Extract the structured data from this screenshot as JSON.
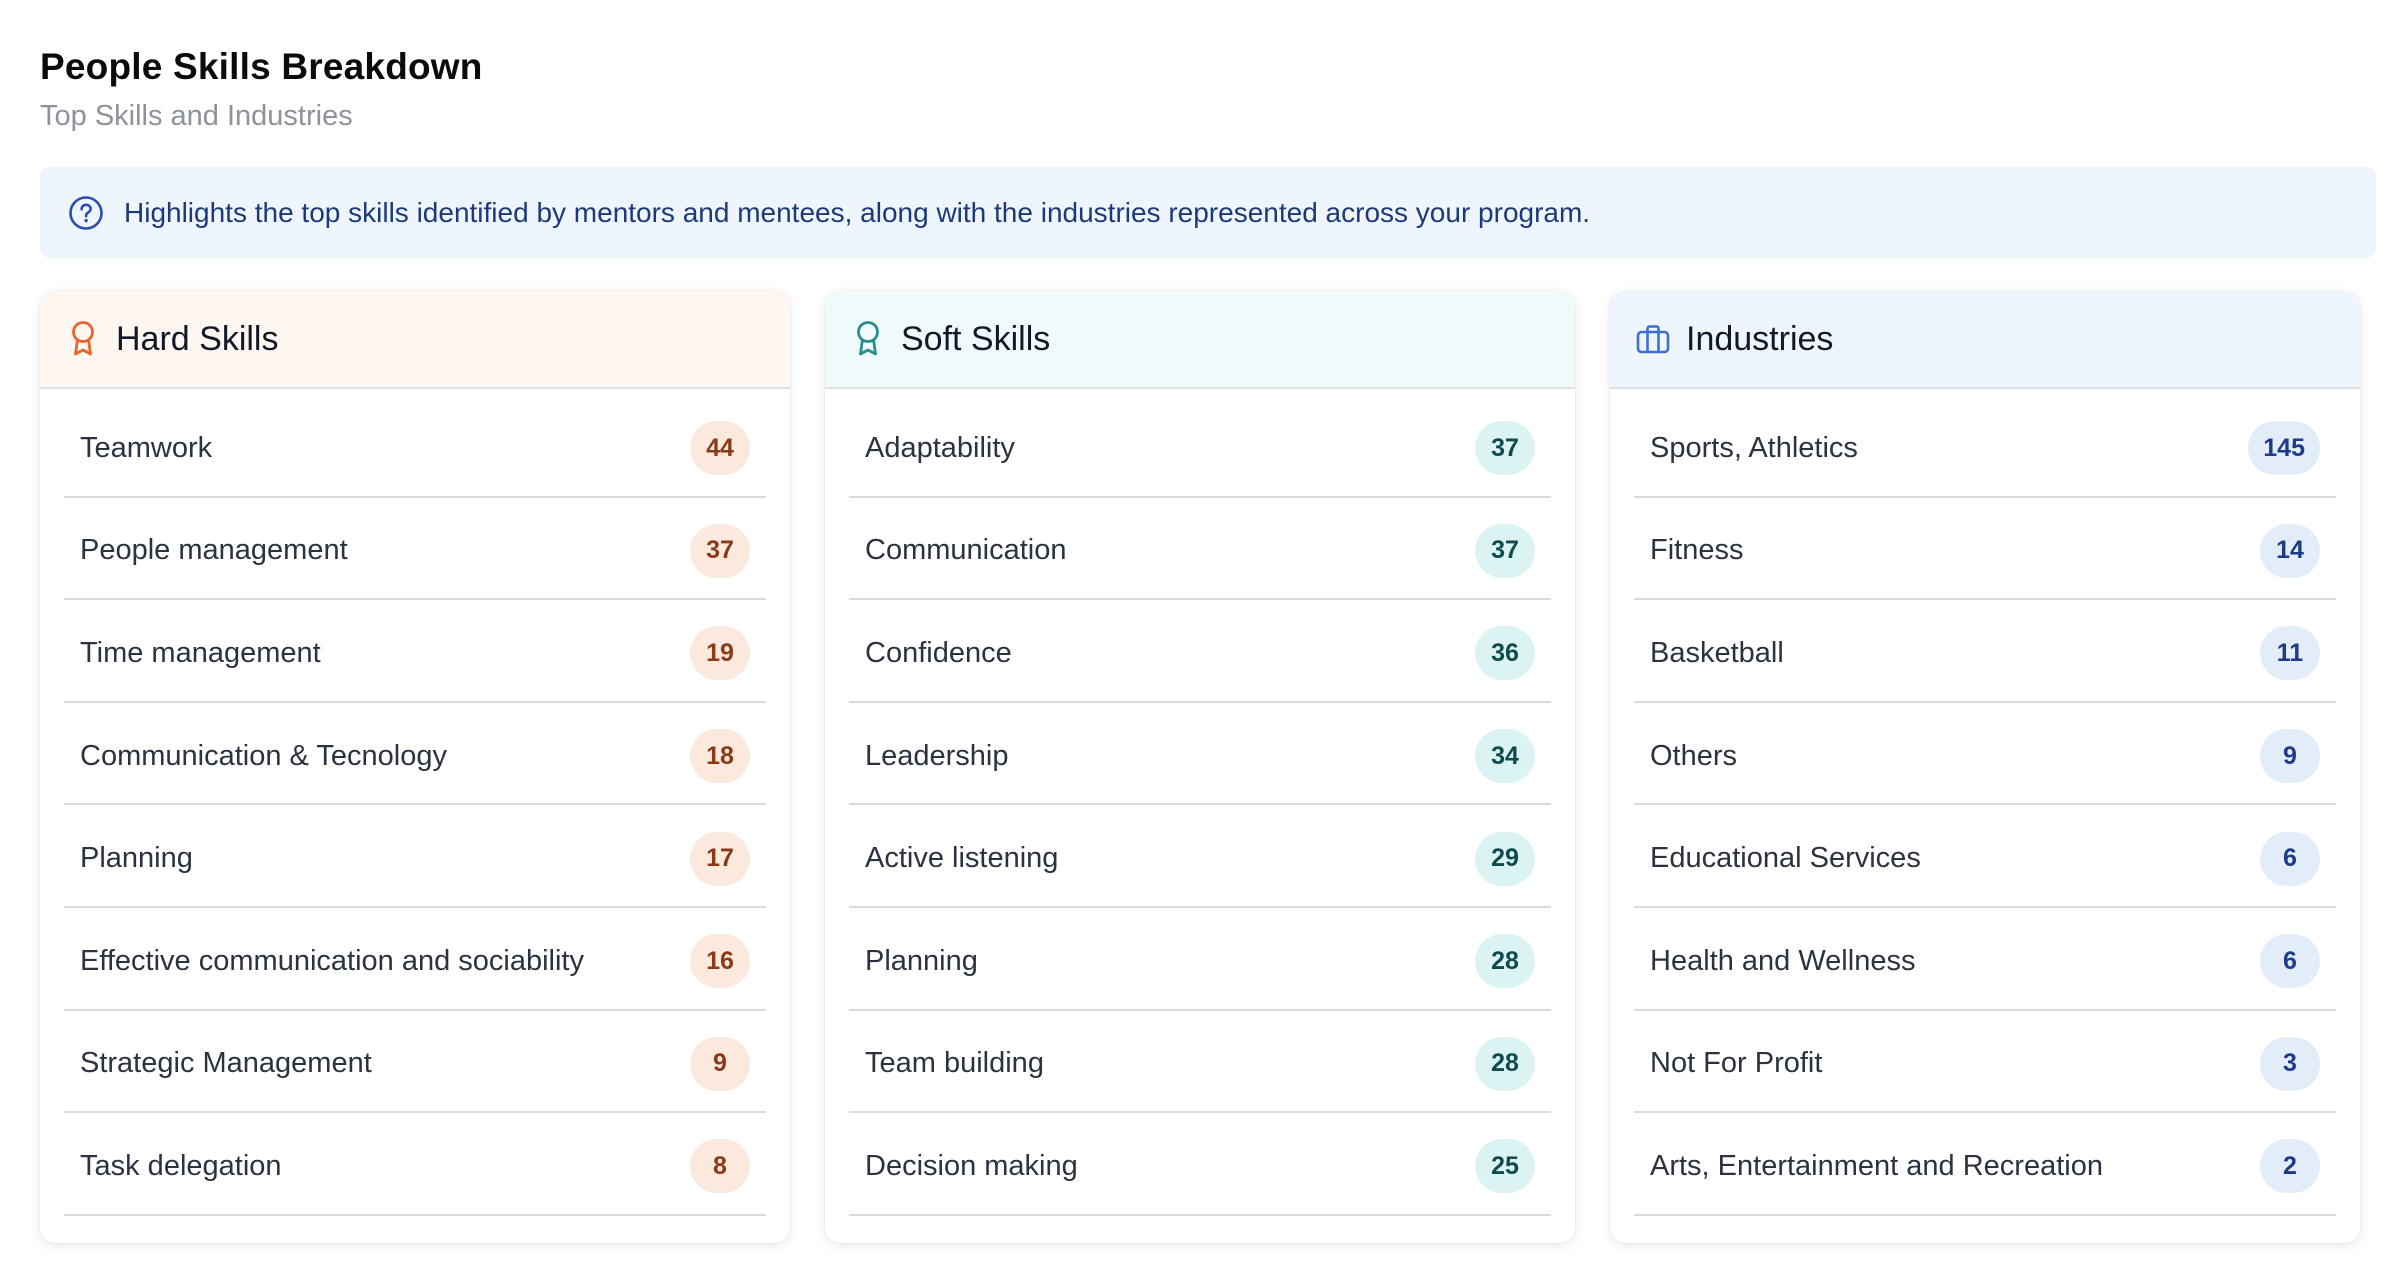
{
  "header": {
    "title": "People Skills Breakdown",
    "subtitle": "Top Skills and Industries"
  },
  "banner": {
    "icon": "help-circle-icon",
    "text": "Highlights the top skills identified by mentors and mentees, along with the industries represented across your program."
  },
  "colors": {
    "hard_accent": "#e8662a",
    "soft_accent": "#2a8c8e",
    "industries_accent": "#3b6fd6"
  },
  "cards": {
    "hard": {
      "title": "Hard Skills",
      "icon": "award-ribbon-icon",
      "items": [
        {
          "label": "Teamwork",
          "count": "44"
        },
        {
          "label": "People management",
          "count": "37"
        },
        {
          "label": "Time management",
          "count": "19"
        },
        {
          "label": "Communication & Tecnology",
          "count": "18"
        },
        {
          "label": "Planning",
          "count": "17"
        },
        {
          "label": "Effective communication and sociability",
          "count": "16"
        },
        {
          "label": "Strategic Management",
          "count": "9"
        },
        {
          "label": "Task delegation",
          "count": "8"
        }
      ]
    },
    "soft": {
      "title": "Soft Skills",
      "icon": "award-ribbon-icon",
      "items": [
        {
          "label": "Adaptability",
          "count": "37"
        },
        {
          "label": "Communication",
          "count": "37"
        },
        {
          "label": "Confidence",
          "count": "36"
        },
        {
          "label": "Leadership",
          "count": "34"
        },
        {
          "label": "Active listening",
          "count": "29"
        },
        {
          "label": "Planning",
          "count": "28"
        },
        {
          "label": "Team building",
          "count": "28"
        },
        {
          "label": "Decision making",
          "count": "25"
        }
      ]
    },
    "industries": {
      "title": "Industries",
      "icon": "briefcase-icon",
      "items": [
        {
          "label": "Sports, Athletics",
          "count": "145"
        },
        {
          "label": "Fitness",
          "count": "14"
        },
        {
          "label": "Basketball",
          "count": "11"
        },
        {
          "label": "Others",
          "count": "9"
        },
        {
          "label": "Educational Services",
          "count": "6"
        },
        {
          "label": "Health and Wellness",
          "count": "6"
        },
        {
          "label": "Not For Profit",
          "count": "3"
        },
        {
          "label": "Arts, Entertainment and Recreation",
          "count": "2"
        }
      ]
    }
  }
}
